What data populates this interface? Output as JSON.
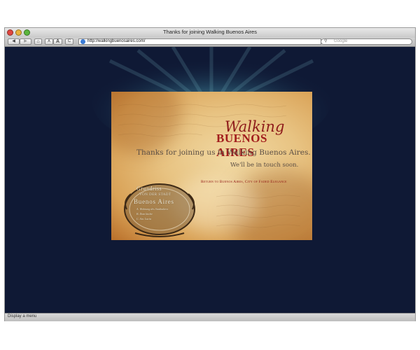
{
  "browser": {
    "window_title": "Thanks for joining Walking Buenos Aires",
    "url": "http://walkingbuenosaires.com/",
    "search_placeholder": "Google",
    "buttons": {
      "back": "◀",
      "forward": "▶",
      "home": "⌂",
      "text_smaller": "A",
      "text_larger": "A",
      "reload": "C"
    },
    "status": "Display a menu"
  },
  "page": {
    "logo_script": "Walking",
    "logo_caps": "BUENOS AIRES",
    "thanks_message": "Thanks for joining us in Walking Buenos Aires.",
    "touch_message": "We'll be in touch soon.",
    "return_link": "Return to Buenos Aires, City of Faded Elegance",
    "seal": {
      "line1": "Grundriss",
      "line2": "VON DER STADT",
      "line3": "Buenos Aires",
      "line4": "A. Wohnung des Statthalters",
      "line5": "B. Dom  kirche",
      "line6": "C. Sta. Lucia"
    }
  },
  "colors": {
    "page_background": "#0f1935",
    "accent_red": "#a21d1d",
    "text_brown": "#5b4e44"
  }
}
